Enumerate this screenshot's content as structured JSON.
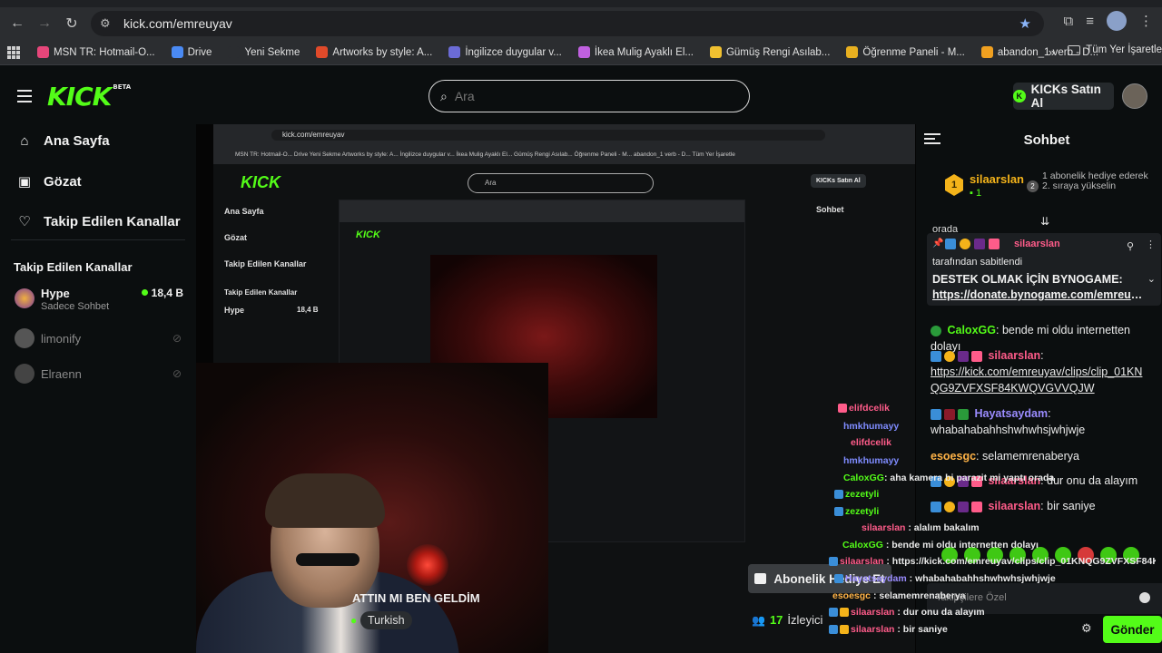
{
  "browser": {
    "url": "kick.com/emreuyav",
    "bookmarks": [
      {
        "label": "MSN TR: Hotmail-O...",
        "color": "#e6467a"
      },
      {
        "label": "Drive",
        "color": "#4a8af4"
      },
      {
        "label": "Yeni Sekme",
        "color": "#2b2d30"
      },
      {
        "label": "Artworks by style: A...",
        "color": "#e04a2a"
      },
      {
        "label": "İngilizce duygular v...",
        "color": "#6b6bd6"
      },
      {
        "label": "İkea Mulig Ayaklı El...",
        "color": "#c060e0"
      },
      {
        "label": "Gümüş Rengi Asılab...",
        "color": "#f0c030"
      },
      {
        "label": "Öğrenme Paneli - M...",
        "color": "#e8b020"
      },
      {
        "label": "abandon_1 verb - D...",
        "color": "#f0a020"
      }
    ],
    "bookmarks_more": "»",
    "all_bookmarks": "Tüm Yer İşaretle"
  },
  "header": {
    "logo": "KICK",
    "logo_badge": "BETA",
    "search_placeholder": "Ara",
    "buy_kicks": "KICKs Satın Al",
    "kicks_symbol": "K"
  },
  "sidebar": {
    "nav": [
      {
        "label": "Ana Sayfa",
        "icon": "home-icon",
        "glyph": "⌂"
      },
      {
        "label": "Gözat",
        "icon": "browse-icon",
        "glyph": "▣"
      },
      {
        "label": "Takip Edilen Kanallar",
        "icon": "heart-icon",
        "glyph": "♡"
      }
    ],
    "followed_title": "Takip Edilen Kanallar",
    "channels": [
      {
        "name": "Hype",
        "sub": "Sadece Sohbet",
        "viewers": "18,4 B",
        "live": true
      },
      {
        "name": "limonify",
        "live": false
      },
      {
        "name": "Elraenn",
        "live": false
      }
    ]
  },
  "stream": {
    "title": "ATTIN MI BEN GELDİM",
    "language": "Turkish",
    "subscribe_label": "Abonelik Hediye Et",
    "viewer_count": "17",
    "viewer_label": "İzleyici"
  },
  "inner_stream": {
    "url": "kick.com/emreuyav",
    "logo": "KICK",
    "search": "Ara",
    "buy": "KICKs Satın Al",
    "chat_title": "Sohbet",
    "nav": [
      "Ana Sayfa",
      "Gözat",
      "Takip Edilen Kanallar"
    ],
    "followed_title": "Takip Edilen Kanallar",
    "channel": "Hype",
    "channel_viewers": "18,4 B",
    "bookmarks": "MSN TR: Hotmail-O...   Drive   Yeni Sekme   Artworks by style: A...   İngilizce duygular v...   İkea Mulig Ayaklı El...   Gümüş Rengi Asılab...   Öğrenme Paneli - M...   abandon_1 verb - D...   Tüm Yer İşaretle"
  },
  "chat": {
    "title": "Sohbet",
    "leaderboard": {
      "rank": "1",
      "name": "silaarslan",
      "count": "1",
      "rank2": "2",
      "description": "1 abonelik hediye ederek 2. sıraya yükselin"
    },
    "pinned": {
      "user": "silaarslan",
      "pinned_by": "tarafından sabitlendi",
      "text": "DESTEK OLMAK İÇİN BYNOGAME:",
      "link": "https://donate.bynogame.com/emreuyav"
    },
    "orada": "orada",
    "messages": [
      {
        "user": "CaloxGG",
        "color": "#53fc18",
        "text": "bende mi oldu internetten dolayı"
      },
      {
        "user": "silaarslan",
        "color": "#ff5c8a",
        "text": "https://kick.com/emreuyav/clips/clip_01KNQG9ZVFXSF84KWQVGVVQJW"
      },
      {
        "user": "Hayatsaydam",
        "color": "#9b8cff",
        "text": "whabahabahhshwhwhsjwhjwje"
      },
      {
        "user": "esoesgc",
        "color": "#ffb347",
        "text": "selamemrenaberya"
      },
      {
        "user": "silaarslan",
        "color": "#ff5c8a",
        "text": "dur onu da alayım"
      },
      {
        "user": "silaarslan",
        "color": "#ff5c8a",
        "text": "bir saniye"
      }
    ],
    "input_placeholder": "Takipçilere Özel",
    "send_label": "Gönder"
  },
  "overlay_chat": [
    {
      "user": "elifdcelik",
      "color": "#ff5c8a",
      "text": ""
    },
    {
      "user": "hmkhumayy",
      "color": "#7f8cff",
      "text": ""
    },
    {
      "user": "elifdcelik",
      "color": "#ff5c8a",
      "text": ""
    },
    {
      "user": "hmkhumayy",
      "color": "#7f8cff",
      "text": ""
    },
    {
      "user": "CaloxGG",
      "color": "#53fc18",
      "text": "aha kamera bi parazit mi yaptı orada"
    },
    {
      "user": "zezetyli",
      "color": "#53fc18",
      "text": "dur onu da alayım"
    },
    {
      "user": "zezetyli",
      "color": "#53fc18",
      "text": ""
    },
    {
      "user": "silaarslan",
      "color": "#ff5c8a",
      "text": "alalım bakalım"
    },
    {
      "user": "CaloxGG",
      "color": "#53fc18",
      "text": "bende mi oldu internetten dolayı"
    },
    {
      "user": "silaarslan",
      "color": "#ff5c8a",
      "text": "https://kick.com/emreuyav/clips/clip_01KNQG9ZVFXSF84KWQVGVVQJW"
    },
    {
      "user": "Hayatsaydam",
      "color": "#9b8cff",
      "text": "whabahabahhshwhwhsjwhjwje"
    },
    {
      "user": "esoesgc",
      "color": "#ffb347",
      "text": "selamemrenaberya"
    },
    {
      "user": "silaarslan",
      "color": "#ff5c8a",
      "text": "dur onu da alayım"
    },
    {
      "user": "silaarslan",
      "color": "#ff5c8a",
      "text": "bir saniye"
    }
  ],
  "colors": {
    "accent": "#53fc18",
    "background": "#0b0e0f",
    "leader": "#f4b31a"
  }
}
